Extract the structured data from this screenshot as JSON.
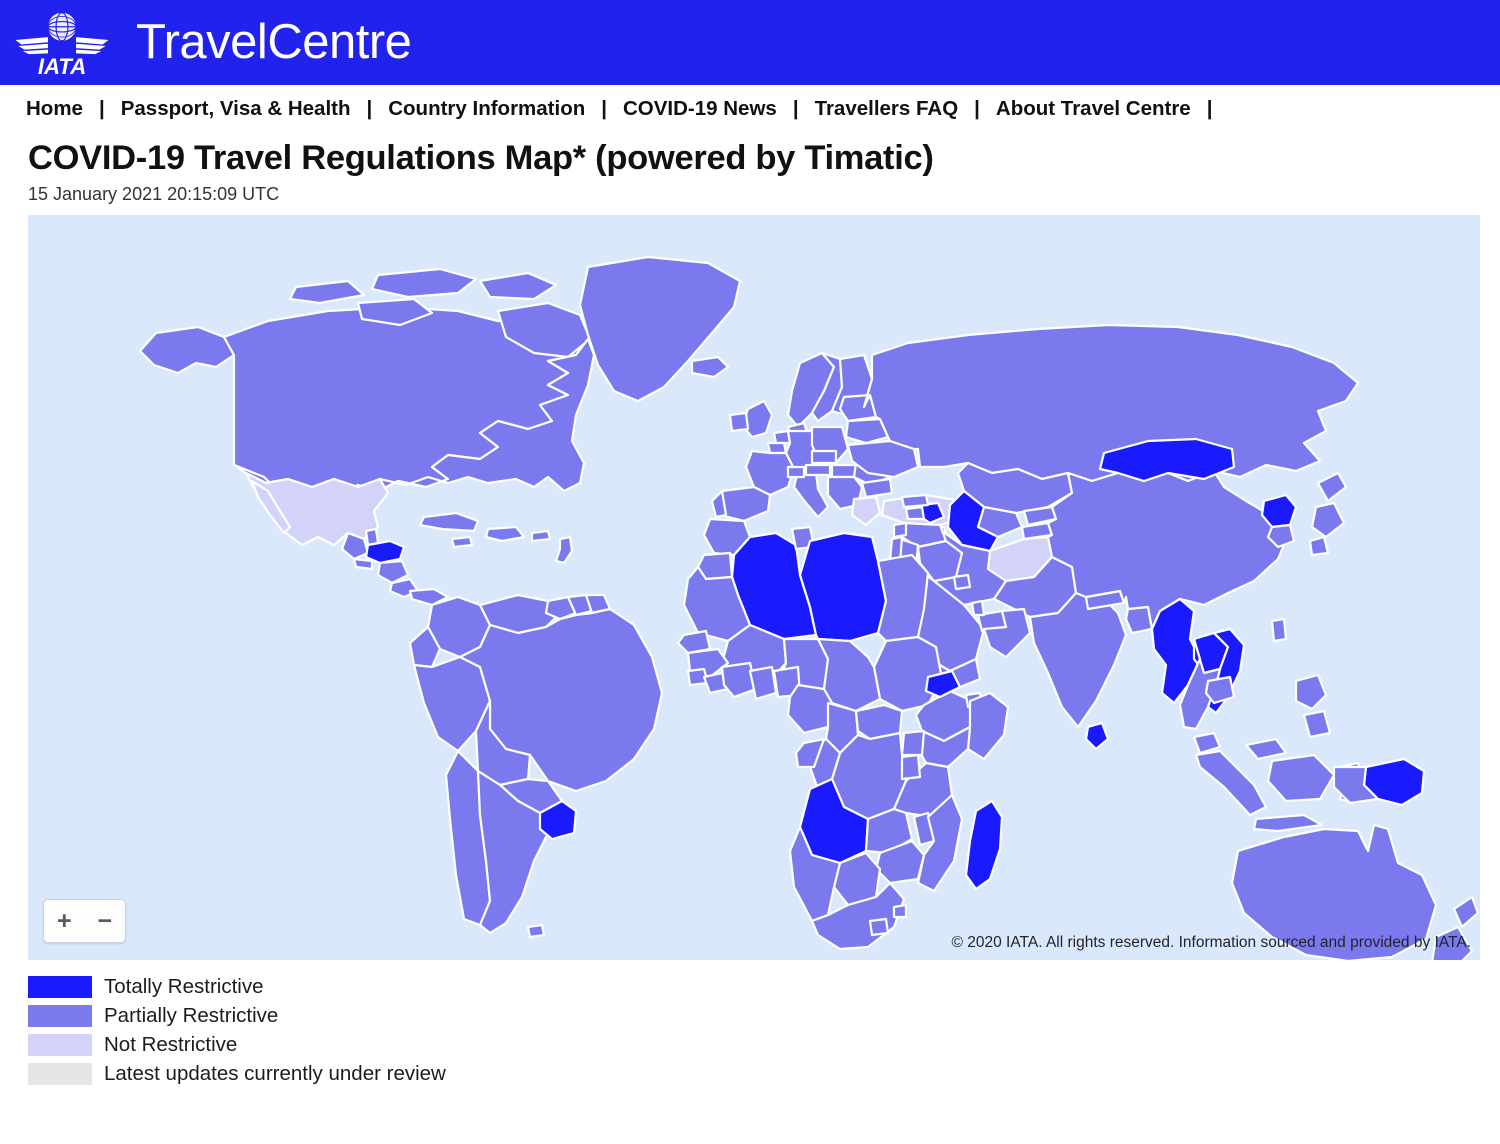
{
  "header": {
    "logo_alt": "IATA",
    "brand": "TravelCentre",
    "background": "#2222ee"
  },
  "nav": {
    "items": [
      {
        "label": "Home"
      },
      {
        "label": "Passport, Visa & Health"
      },
      {
        "label": "Country Information"
      },
      {
        "label": "COVID-19 News"
      },
      {
        "label": "Travellers FAQ"
      },
      {
        "label": "About Travel Centre"
      }
    ],
    "separator": "|"
  },
  "page": {
    "title": "COVID-19 Travel Regulations Map* (powered by Timatic)",
    "timestamp": "15 January 2021 20:15:09 UTC"
  },
  "map": {
    "attribution": "© 2020 IATA. All rights reserved. Information sourced and provided by IATA.",
    "ocean_color": "#d9e8fb",
    "border_color": "#ffffff",
    "zoom_in_label": "+",
    "zoom_out_label": "−"
  },
  "legend": {
    "items": [
      {
        "label": "Totally Restrictive",
        "color": "#1a1aff"
      },
      {
        "label": "Partially Restrictive",
        "color": "#7a7aee"
      },
      {
        "label": "Not Restrictive",
        "color": "#d3d3fa"
      },
      {
        "label": "Latest updates currently under review",
        "color": "#e6e6e6"
      }
    ]
  },
  "chart_data": {
    "type": "map",
    "title": "COVID-19 Travel Regulations Map* (powered by Timatic)",
    "subtitle": "15 January 2021 20:15:09 UTC",
    "projection": "equirectangular-world",
    "categories": [
      "Totally Restrictive",
      "Partially Restrictive",
      "Not Restrictive",
      "Latest updates currently under review"
    ],
    "category_colors": [
      "#1a1aff",
      "#7a7aee",
      "#d3d3fa",
      "#e6e6e6"
    ],
    "default_category": "Partially Restrictive",
    "legend_position": "bottom-left",
    "grid": false,
    "regions": [
      {
        "name": "Algeria",
        "category": "Totally Restrictive"
      },
      {
        "name": "Libya",
        "category": "Totally Restrictive"
      },
      {
        "name": "Angola",
        "category": "Totally Restrictive"
      },
      {
        "name": "Madagascar",
        "category": "Totally Restrictive"
      },
      {
        "name": "Eritrea",
        "category": "Totally Restrictive"
      },
      {
        "name": "Mongolia",
        "category": "Totally Restrictive"
      },
      {
        "name": "North Korea",
        "category": "Totally Restrictive"
      },
      {
        "name": "Myanmar",
        "category": "Totally Restrictive"
      },
      {
        "name": "Laos",
        "category": "Totally Restrictive"
      },
      {
        "name": "Vietnam",
        "category": "Totally Restrictive"
      },
      {
        "name": "Sri Lanka",
        "category": "Totally Restrictive"
      },
      {
        "name": "Turkmenistan",
        "category": "Totally Restrictive"
      },
      {
        "name": "Azerbaijan",
        "category": "Totally Restrictive"
      },
      {
        "name": "Papua New Guinea",
        "category": "Totally Restrictive"
      },
      {
        "name": "Uruguay",
        "category": "Totally Restrictive"
      },
      {
        "name": "Honduras",
        "category": "Totally Restrictive"
      },
      {
        "name": "Mexico",
        "category": "Not Restrictive"
      },
      {
        "name": "Afghanistan",
        "category": "Not Restrictive"
      },
      {
        "name": "United States",
        "category": "Partially Restrictive"
      },
      {
        "name": "Canada",
        "category": "Partially Restrictive"
      },
      {
        "name": "Brazil",
        "category": "Partially Restrictive"
      },
      {
        "name": "Russia",
        "category": "Partially Restrictive"
      },
      {
        "name": "China",
        "category": "Partially Restrictive"
      },
      {
        "name": "India",
        "category": "Partially Restrictive"
      },
      {
        "name": "Australia",
        "category": "Partially Restrictive"
      },
      {
        "name": "Greenland",
        "category": "Partially Restrictive"
      }
    ]
  }
}
